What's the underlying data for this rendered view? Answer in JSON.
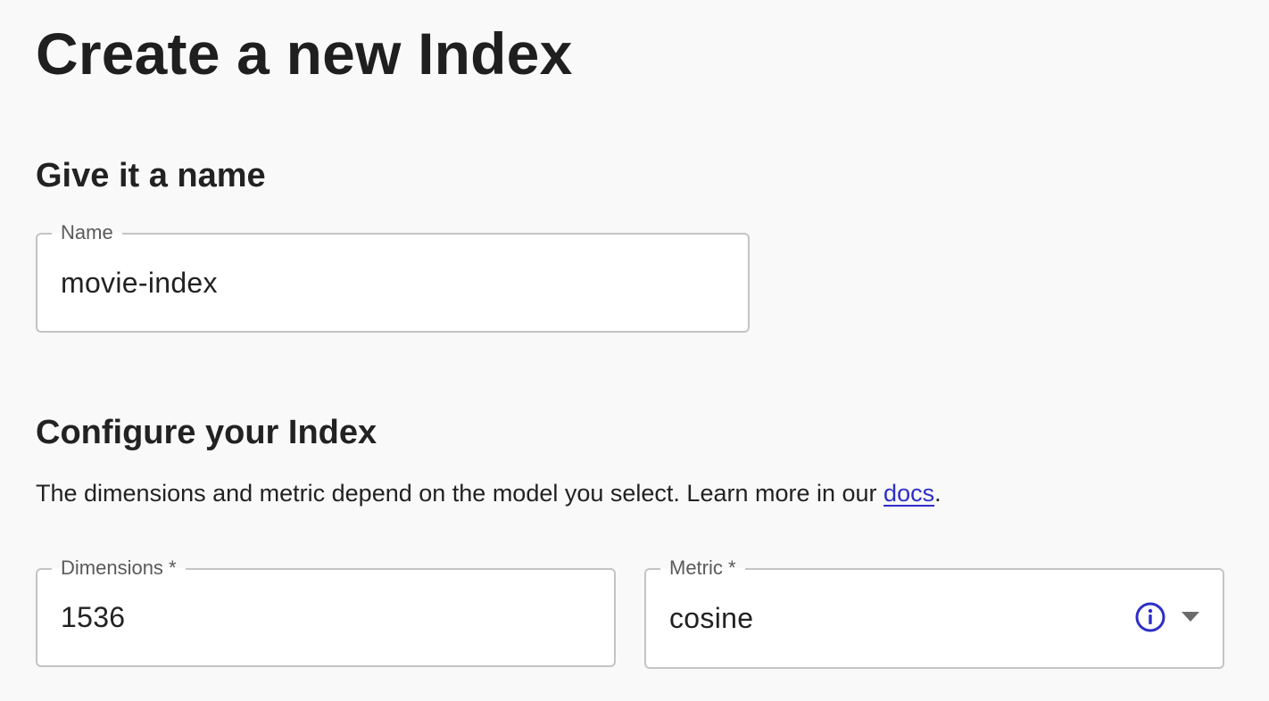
{
  "page": {
    "title": "Create a new Index"
  },
  "name_section": {
    "heading": "Give it a name",
    "name_field": {
      "label": "Name",
      "value": "movie-index"
    }
  },
  "config_section": {
    "heading": "Configure your Index",
    "description_prefix": "The dimensions and metric depend on the model you select. Learn more in our ",
    "docs_link": "docs",
    "description_suffix": ".",
    "dimensions_field": {
      "label": "Dimensions *",
      "value": "1536"
    },
    "metric_field": {
      "label": "Metric *",
      "value": "cosine",
      "info_icon": "info-circle-icon",
      "dropdown_icon": "caret-down-icon"
    }
  },
  "colors": {
    "background": "#f9f9f9",
    "accent": "#2e2ec8",
    "border": "#c4c4c4"
  }
}
